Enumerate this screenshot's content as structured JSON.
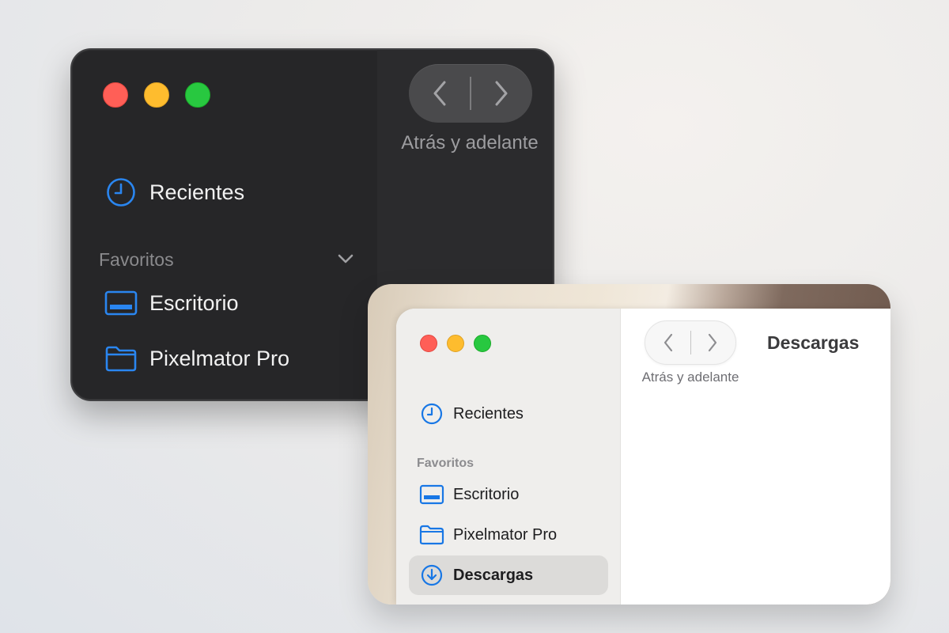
{
  "colors": {
    "accent": "#1877e5",
    "close": "#ff5f57",
    "minimize": "#febc2e",
    "zoom": "#28c840",
    "dark_bg": "#262628",
    "light_sidebar_bg": "#efeeec",
    "selected_bg": "#dcdbd9"
  },
  "dark_window": {
    "nav_label": "Atrás y adelante",
    "recents": {
      "label": "Recientes",
      "icon": "clock-icon"
    },
    "favorites_header": "Favoritos",
    "favorites": [
      {
        "label": "Escritorio",
        "icon": "desktop-icon"
      },
      {
        "label": "Pixelmator Pro",
        "icon": "folder-icon"
      }
    ]
  },
  "light_window": {
    "nav_label": "Atrás y adelante",
    "title": "Descargas",
    "recents": {
      "label": "Recientes",
      "icon": "clock-icon"
    },
    "favorites_header": "Favoritos",
    "favorites": [
      {
        "label": "Escritorio",
        "icon": "desktop-icon"
      },
      {
        "label": "Pixelmator Pro",
        "icon": "folder-icon"
      },
      {
        "label": "Descargas",
        "icon": "download-icon",
        "selected": true
      }
    ]
  }
}
